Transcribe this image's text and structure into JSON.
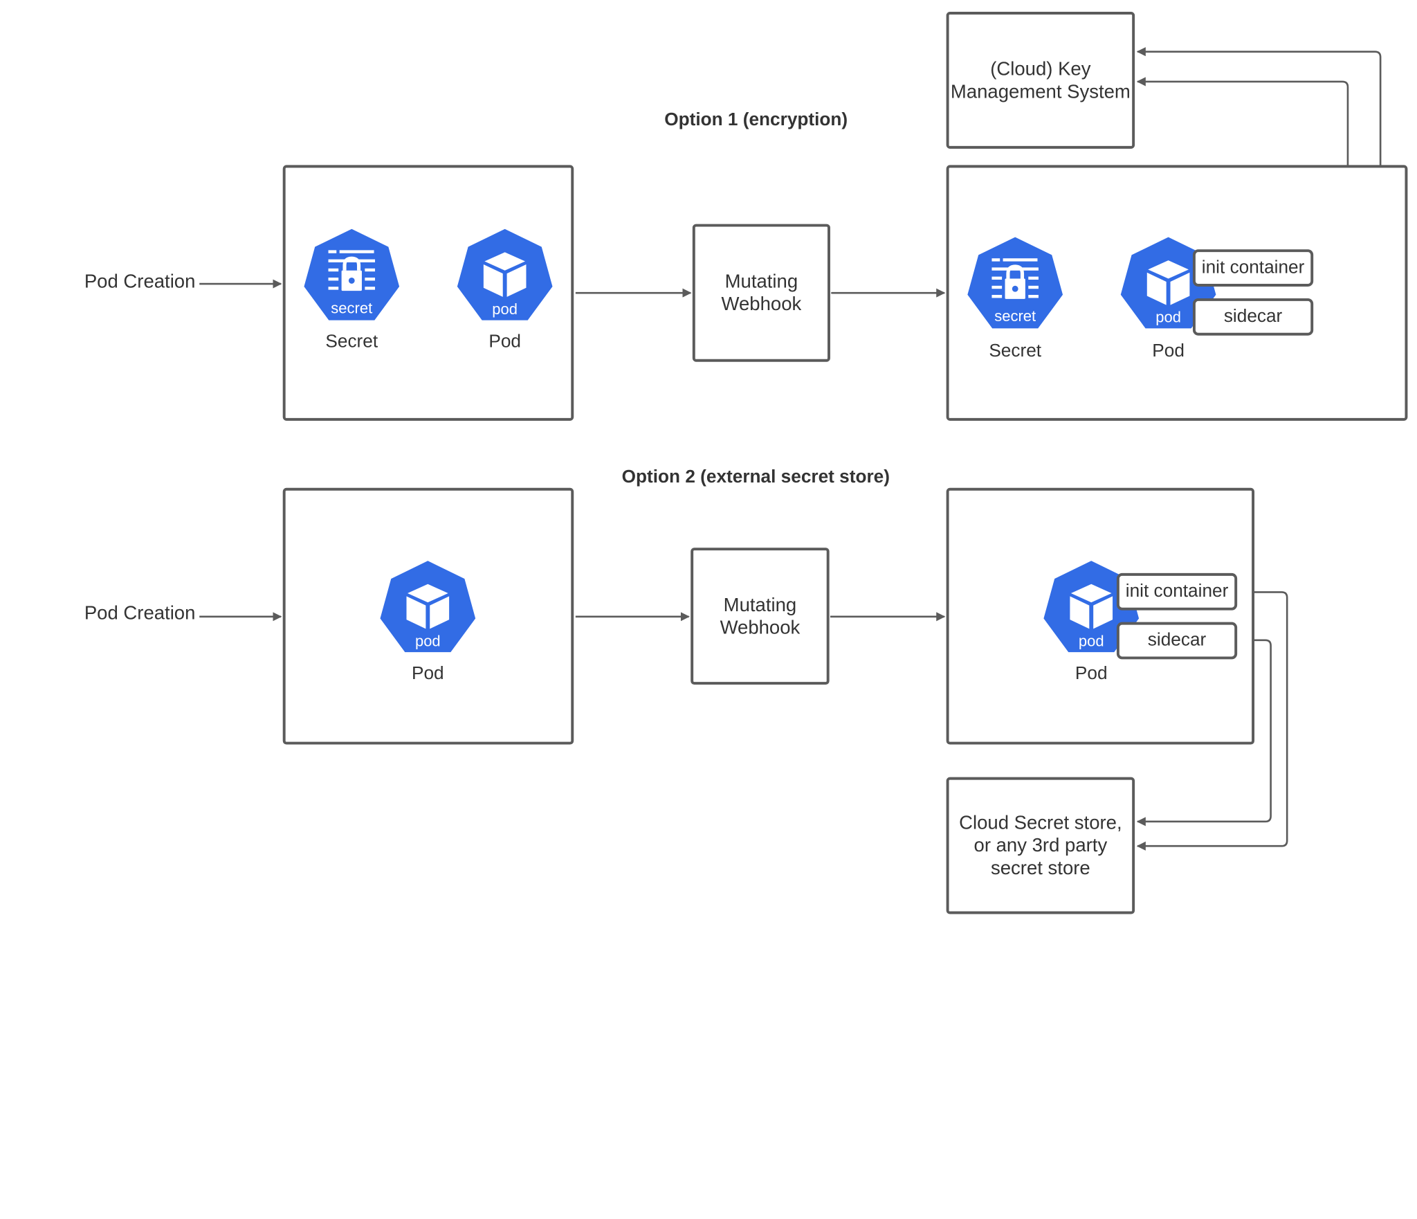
{
  "diagram": {
    "option1_title": "Option 1 (encryption)",
    "option2_title": "Option 2 (external secret store)",
    "pod_creation_label": "Pod Creation",
    "webhook_label": "Mutating\nWebhook",
    "kms_label": "(Cloud) Key\nManagement System",
    "secret_store_label": "Cloud Secret store,\nor any 3rd party\nsecret store",
    "init_container_label": "init container",
    "sidecar_label": "sidecar",
    "secret_caption": "Secret",
    "pod_caption": "Pod",
    "secret_icon_text": "secret",
    "pod_icon_text": "pod"
  },
  "colors": {
    "k8s_blue": "#326ce5",
    "line": "#5b5b5b",
    "text": "#333333"
  }
}
